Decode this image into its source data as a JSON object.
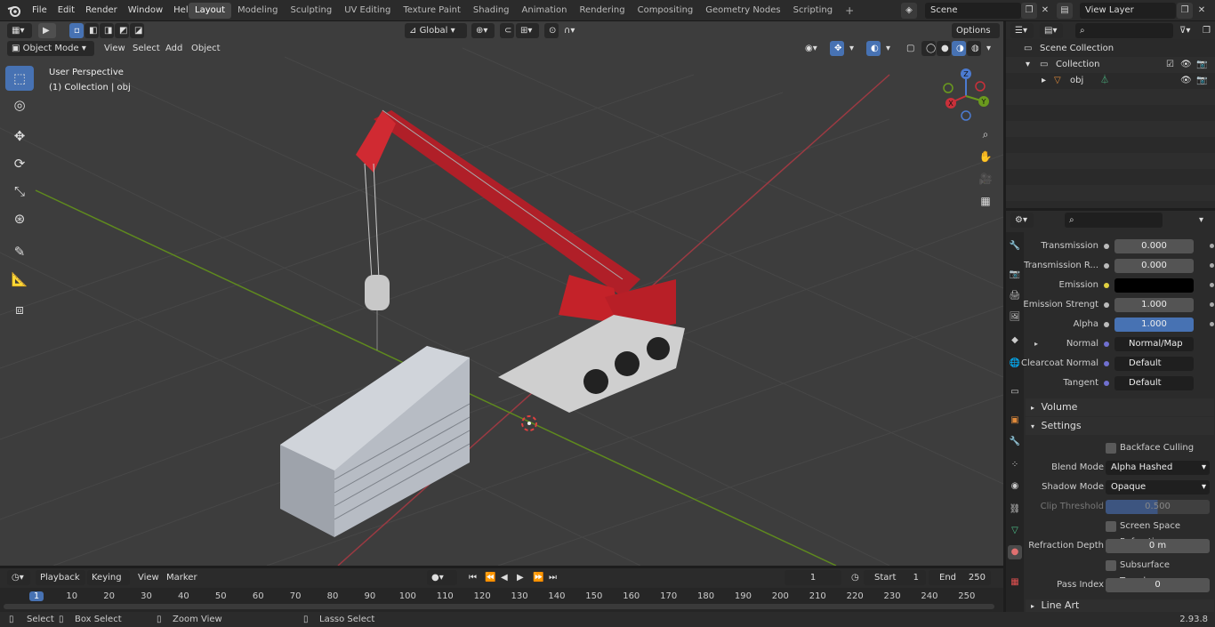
{
  "topbar": {
    "menu": [
      "File",
      "Edit",
      "Render",
      "Window",
      "Help"
    ],
    "workspaces": [
      "Layout",
      "Modeling",
      "Sculpting",
      "UV Editing",
      "Texture Paint",
      "Shading",
      "Animation",
      "Rendering",
      "Compositing",
      "Geometry Nodes",
      "Scripting"
    ],
    "active_workspace": "Layout",
    "scene": "Scene",
    "view_layer": "View Layer"
  },
  "viewport": {
    "mode": "Object Mode",
    "menu": [
      "View",
      "Select",
      "Add",
      "Object"
    ],
    "transform_orientation": "Global",
    "options_label": "Options",
    "perspective_label": "User Perspective",
    "collection_label": "(1) Collection | obj",
    "gizmo": {
      "x": "X",
      "y": "Y",
      "z": "Z"
    }
  },
  "outliner": {
    "scene_collection": "Scene Collection",
    "collection": "Collection",
    "object": "obj"
  },
  "properties": {
    "fields": [
      {
        "label": "Transmission",
        "value": "0.000"
      },
      {
        "label": "Transmission R...",
        "value": "0.000"
      },
      {
        "label": "Emission",
        "value": ""
      },
      {
        "label": "Emission Strengt",
        "value": "1.000"
      },
      {
        "label": "Alpha",
        "value": "1.000"
      },
      {
        "label": "Normal",
        "value": "Normal/Map"
      },
      {
        "label": "Clearcoat Normal",
        "value": "Default"
      },
      {
        "label": "Tangent",
        "value": "Default"
      }
    ],
    "sections": {
      "volume": "Volume",
      "settings": "Settings",
      "line_art": "Line Art"
    },
    "settings": {
      "backface_culling": "Backface Culling",
      "blend_mode_label": "Blend Mode",
      "blend_mode": "Alpha Hashed",
      "shadow_mode_label": "Shadow Mode",
      "shadow_mode": "Opaque",
      "clip_threshold_label": "Clip Threshold",
      "clip_threshold": "0.500",
      "ssr": "Screen Space Refraction",
      "refraction_depth_label": "Refraction Depth",
      "refraction_depth": "0 m",
      "sss_translucency": "Subsurface Translucency",
      "pass_index_label": "Pass Index",
      "pass_index": "0"
    }
  },
  "timeline": {
    "menu": [
      "Playback",
      "Keying",
      "View",
      "Marker"
    ],
    "current_frame": "1",
    "start_label": "Start",
    "start": "1",
    "end_label": "End",
    "end": "250",
    "ruler": [
      "1",
      "10",
      "20",
      "30",
      "40",
      "50",
      "60",
      "70",
      "80",
      "90",
      "100",
      "110",
      "120",
      "130",
      "140",
      "150",
      "160",
      "170",
      "180",
      "190",
      "200",
      "210",
      "220",
      "230",
      "240",
      "250"
    ]
  },
  "statusbar": {
    "select": "Select",
    "box_select": "Box Select",
    "zoom_view": "Zoom View",
    "lasso_select": "Lasso Select",
    "version": "2.93.8"
  },
  "colors": {
    "accent": "#4772b3",
    "crane_red": "#c0202a",
    "axis_x": "#c9303a",
    "axis_y": "#6a9a1e"
  }
}
